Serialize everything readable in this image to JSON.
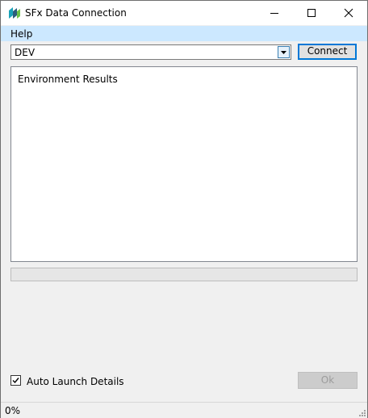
{
  "window": {
    "title": "SFx Data Connection",
    "icon": "sfx-app-icon"
  },
  "menu": {
    "items": [
      {
        "label": "Help"
      }
    ]
  },
  "connection": {
    "environment_value": "DEV",
    "connect_label": "Connect"
  },
  "results": {
    "text": "Environment Results"
  },
  "progress": {
    "value": 0
  },
  "options": {
    "auto_launch_label": "Auto Launch Details",
    "auto_launch_checked": true
  },
  "actions": {
    "ok_label": "Ok",
    "ok_enabled": false
  },
  "status": {
    "text": "0%"
  },
  "colors": {
    "menubar_bg": "#cce8ff",
    "accent": "#0078d7",
    "icon_teal": "#1aa3b8"
  }
}
